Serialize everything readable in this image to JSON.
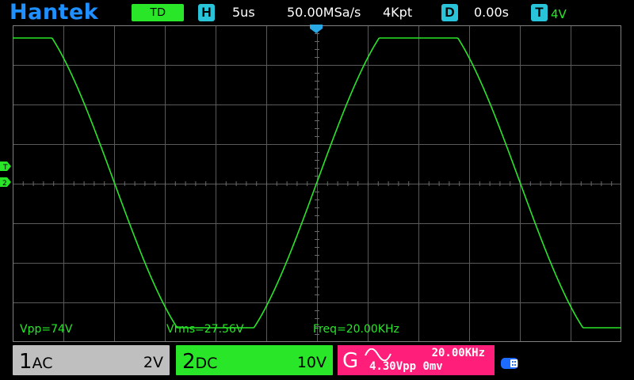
{
  "header": {
    "brand": "Hantek",
    "mode": "TD",
    "horizontal": {
      "icon": "H",
      "timebase": "5us"
    },
    "sample_rate": "50.00MSa/s",
    "memory_depth": "4Kpt",
    "delay": {
      "icon": "D",
      "value": "0.00s"
    },
    "trigger": {
      "icon": "T",
      "level": "4V"
    }
  },
  "markers": {
    "trigger_marker": "T",
    "ch2_marker": "2"
  },
  "measurements": {
    "vpp": "Vpp=74V",
    "vrms": "Vrms=27.56V",
    "freq": "Freq=20.00KHz"
  },
  "channels": [
    {
      "number": "1",
      "coupling": "AC",
      "scale": "2V"
    },
    {
      "number": "2",
      "coupling": "DC",
      "scale": "10V"
    }
  ],
  "generator": {
    "label": "G",
    "waveform": "sine-wave-icon",
    "frequency": "20.00KHz",
    "amplitude": "4.30Vpp",
    "offset": "0mv"
  },
  "colors": {
    "brand": "#1e90ff",
    "ch1": "#bfbfbf",
    "ch2": "#29e629",
    "generator": "#ff1f7a",
    "accent_icon": "#29c4d9",
    "trace": "#29e629"
  }
}
